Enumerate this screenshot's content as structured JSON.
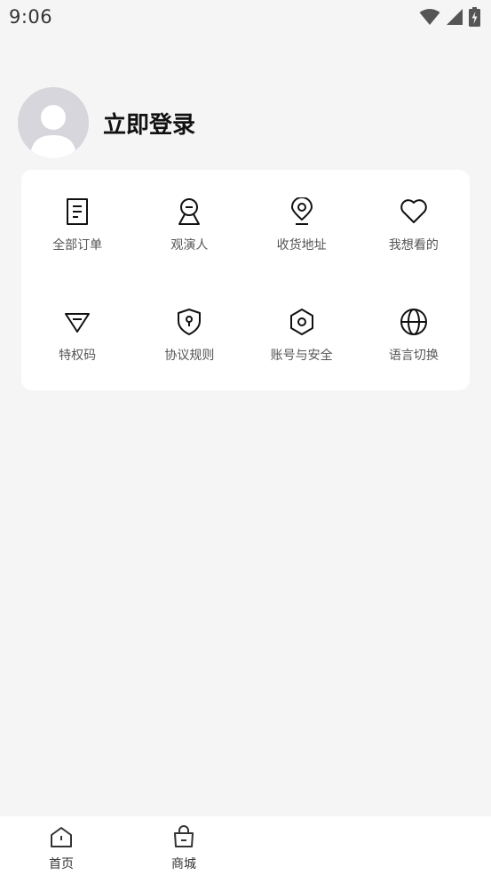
{
  "status_bar": {
    "time": "9:06",
    "icons": [
      "wifi-icon",
      "signal-icon",
      "battery-charging-icon"
    ]
  },
  "profile": {
    "login_label": "立即登录",
    "avatar_icon": "default-avatar-icon"
  },
  "menu": {
    "items": [
      {
        "label": "全部订单",
        "icon": "order-document-icon"
      },
      {
        "label": "观演人",
        "icon": "audience-person-icon"
      },
      {
        "label": "收货地址",
        "icon": "location-pin-icon"
      },
      {
        "label": "我想看的",
        "icon": "heart-icon"
      },
      {
        "label": "特权码",
        "icon": "diamond-icon"
      },
      {
        "label": "协议规则",
        "icon": "shield-lock-icon"
      },
      {
        "label": "账号与安全",
        "icon": "hexagon-settings-icon"
      },
      {
        "label": "语言切换",
        "icon": "globe-icon"
      }
    ]
  },
  "bottom_nav": {
    "items": [
      {
        "label": "首页",
        "icon": "home-icon"
      },
      {
        "label": "商城",
        "icon": "shopping-bag-icon"
      }
    ]
  },
  "colors": {
    "background": "#f5f5f5",
    "card": "#ffffff",
    "avatar_bg": "#d6d6dc",
    "text_primary": "#111111",
    "text_secondary": "#555555"
  }
}
